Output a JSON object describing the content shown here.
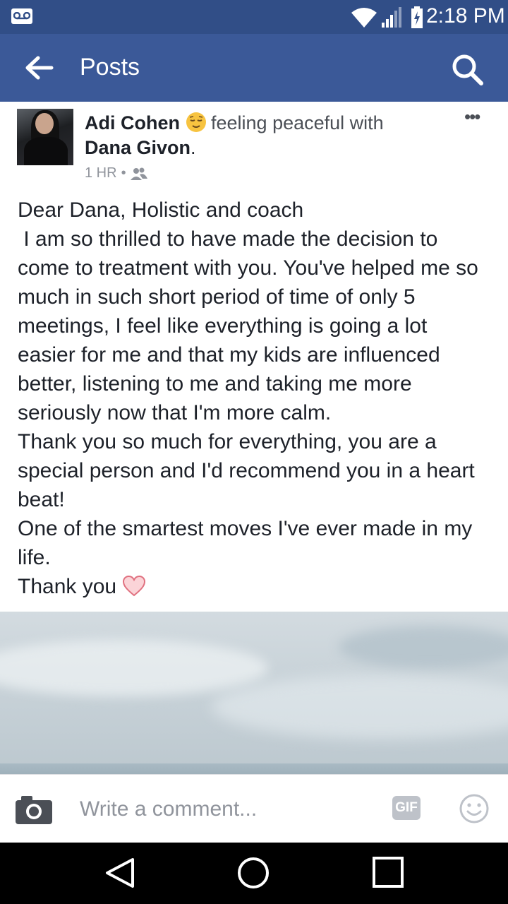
{
  "status_bar": {
    "time": "2:18 PM",
    "icons": [
      "voicemail-icon",
      "wifi-icon",
      "signal-icon",
      "battery-charging-icon"
    ]
  },
  "app_bar": {
    "title": "Posts",
    "back_icon": "arrow-left-icon",
    "search_icon": "search-icon",
    "background": "#3b5998"
  },
  "post": {
    "author": "Adi Cohen",
    "feeling": "feeling peaceful with",
    "feeling_icon": "relieved-face-emoji",
    "tagged": "Dana Givon",
    "tagged_suffix": ".",
    "time": "1 HR",
    "separator": "•",
    "audience_icon": "friends-icon",
    "more_icon": "more-dots-icon",
    "body": "Dear Dana, Holistic and coach\n I am so thrilled to have made the decision to come to treatment with you. You've helped me so much in such short period of time of only 5 meetings, I feel like everything is going a lot easier for me and that my kids are influenced better, listening to me and taking me more seriously now that I'm more calm.\nThank you so much for everything, you are a special person and I'd recommend you in a heart beat!\nOne of the smartest moves I've ever made in my life.",
    "closing": "Thank you",
    "closing_icon": "heart-icon"
  },
  "comment_bar": {
    "placeholder": "Write a comment...",
    "camera_icon": "camera-icon",
    "gif_label": "GIF",
    "emoji_icon": "smiley-icon"
  },
  "nav_bar": {
    "icons": [
      "back-triangle-icon",
      "home-circle-icon",
      "recents-square-icon"
    ]
  }
}
